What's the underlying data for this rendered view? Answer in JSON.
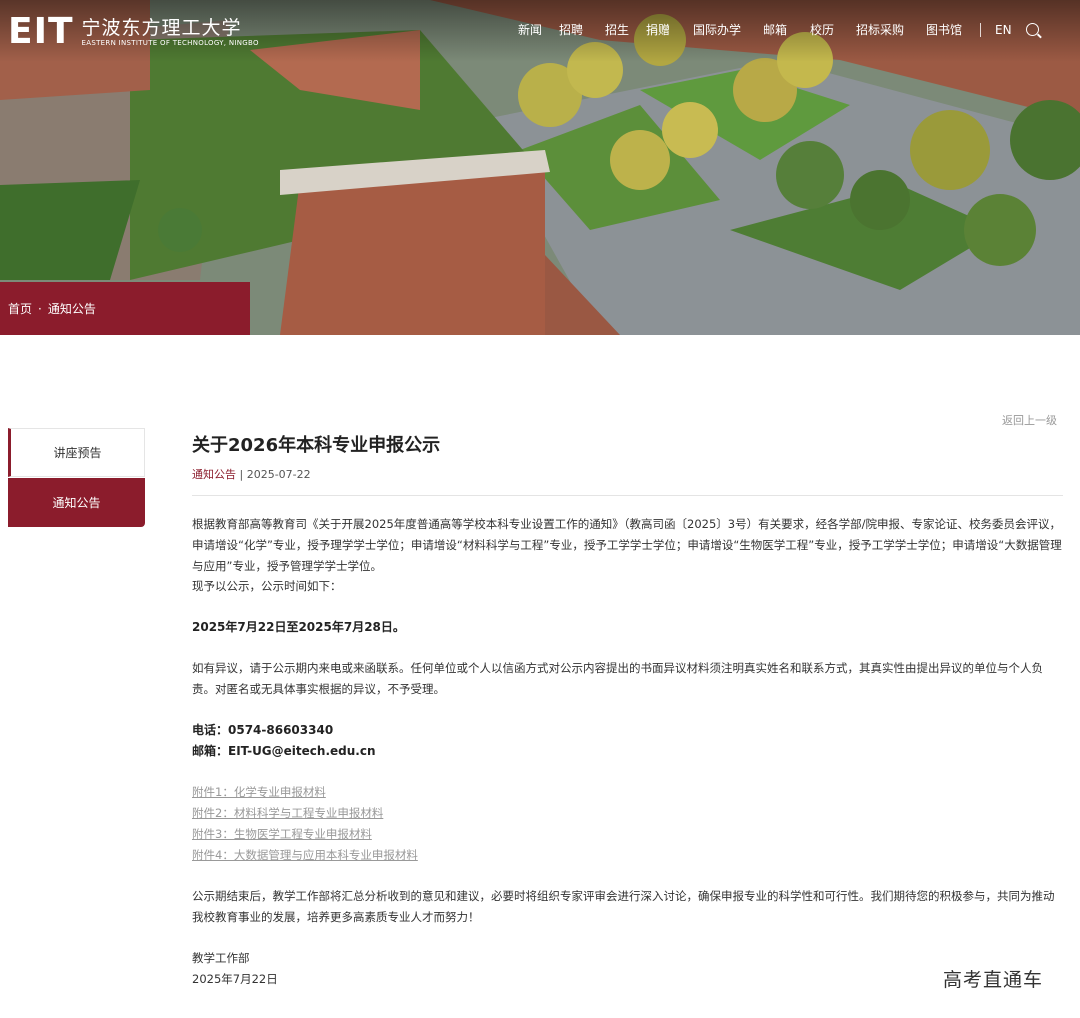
{
  "header": {
    "logo_mark": "EIT",
    "logo_cn": "宁波东方理工大学",
    "logo_en": "EASTERN INSTITUTE OF TECHNOLOGY, NINGBO",
    "nav": [
      "新闻",
      "招聘",
      "招生",
      "捐赠",
      "国际办学",
      "邮箱",
      "校历",
      "招标采购",
      "图书馆"
    ],
    "lang": "EN"
  },
  "breadcrumb": {
    "home": "首页",
    "sep": "·",
    "current": "通知公告"
  },
  "sidebar": {
    "items": [
      {
        "label": "讲座预告"
      },
      {
        "label": "通知公告"
      }
    ]
  },
  "article": {
    "back_label": "返回上一级",
    "title": "关于2026年本科专业申报公示",
    "category": "通知公告",
    "meta_sep": " | ",
    "date": "2025-07-22",
    "p1": "根据教育部高等教育司《关于开展2025年度普通高等学校本科专业设置工作的通知》（教高司函〔2025〕3号）有关要求，经各学部/院申报、专家论证、校务委员会评议，申请增设“化学”专业，授予理学学士学位；申请增设“材料科学与工程”专业，授予工学学士学位；申请增设“生物医学工程”专业，授予工学学士学位；申请增设“大数据管理与应用”专业，授予管理学学士学位。",
    "p2": "现予以公示，公示时间如下：",
    "period": "2025年7月22日至2025年7月28日。",
    "p3": "如有异议，请于公示期内来电或来函联系。任何单位或个人以信函方式对公示内容提出的书面异议材料须注明真实姓名和联系方式，其真实性由提出异议的单位与个人负责。对匿名或无具体事实根据的异议，不予受理。",
    "phone": "电话：0574-86603340",
    "email": "邮箱：EIT-UG@eitech.edu.cn",
    "attachments": [
      "附件1：化学专业申报材料",
      "附件2：材料科学与工程专业申报材料",
      "附件3：生物医学工程专业申报材料",
      "附件4：大数据管理与应用本科专业申报材料"
    ],
    "p4": "公示期结束后，教学工作部将汇总分析收到的意见和建议，必要时将组织专家评审会进行深入讨论，确保申报专业的科学性和可行性。我们期待您的积极参与，共同为推动我校教育事业的发展，培养更多高素质专业人才而努力！",
    "sign_dept": "教学工作部",
    "sign_date": "2025年7月22日"
  },
  "watermark": "高考直通车",
  "colors": {
    "brand": "#8b1c2c"
  }
}
